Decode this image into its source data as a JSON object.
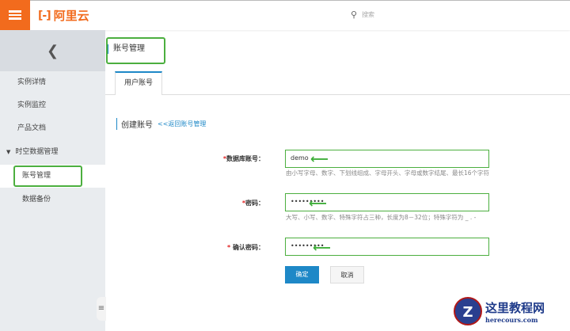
{
  "header": {
    "logo": "阿里云",
    "logo_mark": "[-]",
    "search_placeholder": "搜索"
  },
  "sidebar": {
    "items": [
      {
        "label": "实例详情"
      },
      {
        "label": "实例监控"
      },
      {
        "label": "产品文档"
      },
      {
        "label": "时空数据管理"
      },
      {
        "label": "账号管理"
      },
      {
        "label": "数据备份"
      }
    ]
  },
  "page": {
    "title": "账号管理",
    "tab": "用户账号",
    "section": "创建账号",
    "back_link": "<<返回账号管理"
  },
  "form": {
    "account_label": "数据库账号：",
    "account_value": "demo",
    "account_hint": "由小写字母、数字、下划线组成、字母开头、字母或数字结尾、最长16个字符",
    "password_label": "密码：",
    "password_value": "•••••••••",
    "password_hint": "大写、小写、数字、特殊字符占三种，长度为8－32位；特殊字符为 _ . -",
    "confirm_label": "确认密码：",
    "confirm_value": "•••••••••",
    "required": "*",
    "ok": "确定",
    "cancel": "取消"
  },
  "watermark": {
    "name": "这里教程网",
    "url": "herecours.com",
    "letter": "Z"
  },
  "colors": {
    "brand": "#f26b1d",
    "primary": "#1e88c7",
    "highlight": "#4caf3f"
  }
}
